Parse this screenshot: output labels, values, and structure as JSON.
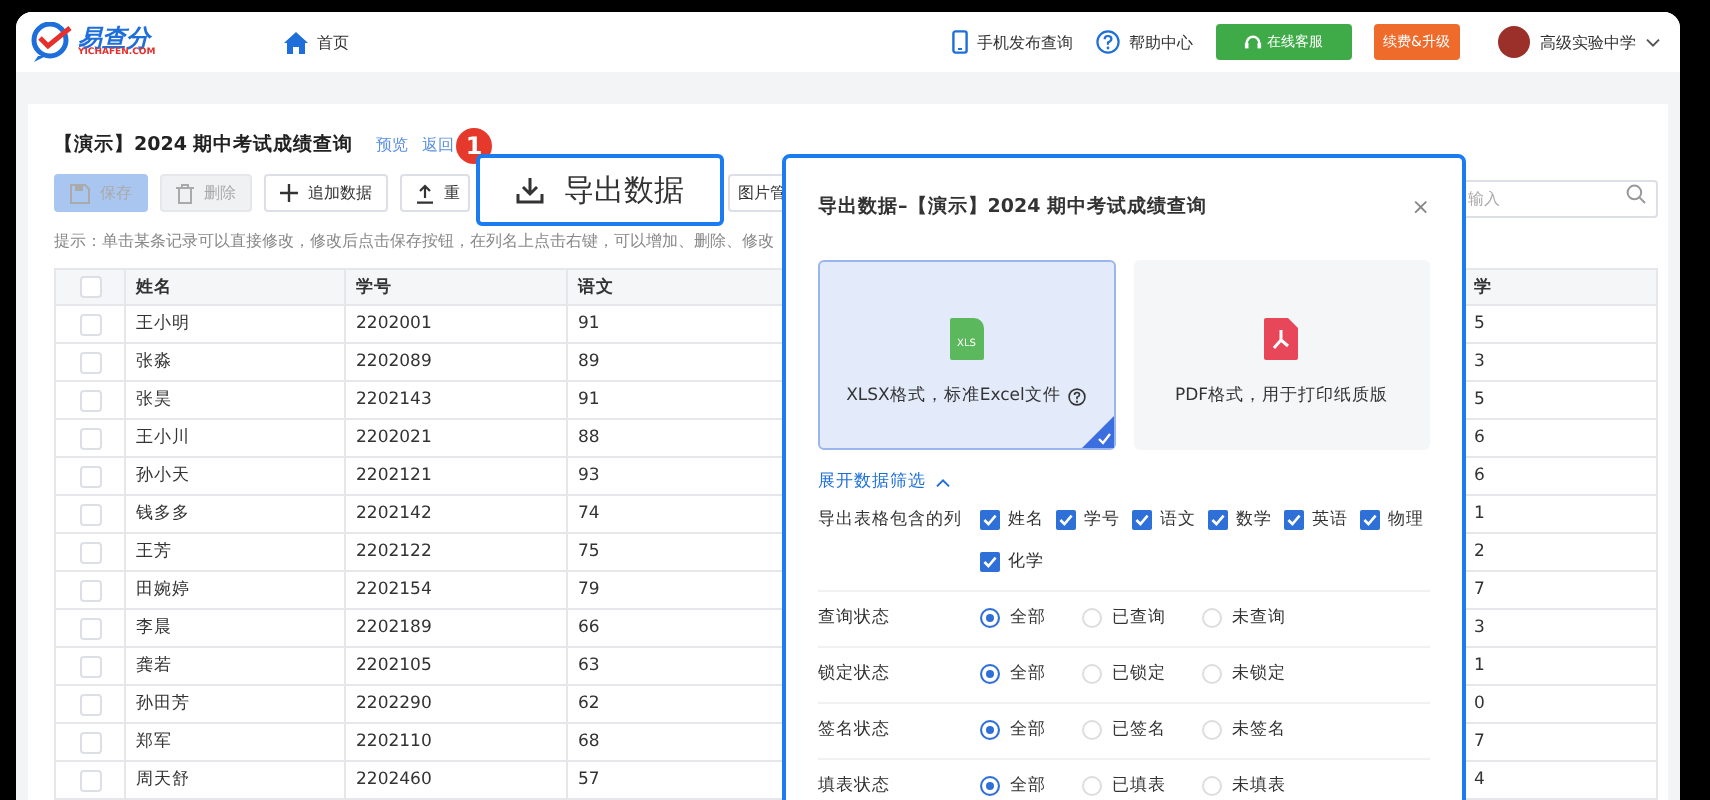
{
  "header": {
    "logo": {
      "name": "易查分",
      "domain": "YICHAFEN.COM"
    },
    "home": "首页",
    "links": [
      {
        "kind": "phone",
        "label": "手机发布查询"
      },
      {
        "kind": "help",
        "label": "帮助中心"
      }
    ],
    "buttons": [
      {
        "kind": "support",
        "label": "在线客服"
      },
      {
        "kind": "upgrade",
        "label": "续费&升级"
      }
    ],
    "user": "高级实验中学"
  },
  "page": {
    "title": "【演示】2024 期中考试成绩查询",
    "links": [
      "预览",
      "返回"
    ],
    "toolbar": [
      {
        "kind": "save",
        "label": "保存",
        "disabled": true
      },
      {
        "kind": "delete",
        "label": "删除",
        "disabled": true
      },
      {
        "kind": "add",
        "label": "追加数据",
        "disabled": false
      },
      {
        "kind": "import",
        "label": "重",
        "disabled": false
      },
      {
        "kind": "image",
        "label": "图片管",
        "disabled": false
      }
    ],
    "search": {
      "placeholder": "输入"
    },
    "hint": "提示：单击某条记录可以直接修改，修改后点击保存按钮，在列名上点击右键，可以增加、删除、修改"
  },
  "table": {
    "all_checked": false,
    "columns": [
      "姓名",
      "学号",
      "语文"
    ],
    "last_column": "学",
    "rows": [
      {
        "checked": false,
        "cells": [
          "王小明",
          "2202001",
          "91"
        ],
        "last": "5"
      },
      {
        "checked": false,
        "cells": [
          "张淼",
          "2202089",
          "89"
        ],
        "last": "3"
      },
      {
        "checked": false,
        "cells": [
          "张昊",
          "2202143",
          "91"
        ],
        "last": "5"
      },
      {
        "checked": false,
        "cells": [
          "王小川",
          "2202021",
          "88"
        ],
        "last": "6"
      },
      {
        "checked": false,
        "cells": [
          "孙小天",
          "2202121",
          "93"
        ],
        "last": "6"
      },
      {
        "checked": false,
        "cells": [
          "钱多多",
          "2202142",
          "74"
        ],
        "last": "1"
      },
      {
        "checked": false,
        "cells": [
          "王芳",
          "2202122",
          "75"
        ],
        "last": "2"
      },
      {
        "checked": false,
        "cells": [
          "田婉婷",
          "2202154",
          "79"
        ],
        "last": "7"
      },
      {
        "checked": false,
        "cells": [
          "李晨",
          "2202189",
          "66"
        ],
        "last": "3"
      },
      {
        "checked": false,
        "cells": [
          "龚若",
          "2202105",
          "63"
        ],
        "last": "1"
      },
      {
        "checked": false,
        "cells": [
          "孙田芳",
          "2202290",
          "62"
        ],
        "last": "0"
      },
      {
        "checked": false,
        "cells": [
          "郑军",
          "2202110",
          "68"
        ],
        "last": "7"
      },
      {
        "checked": false,
        "cells": [
          "周天舒",
          "2202460",
          "57"
        ],
        "last": "4"
      }
    ]
  },
  "callout": {
    "step": "1",
    "label": "导出数据"
  },
  "dialog": {
    "title": "导出数据–【演示】2024 期中考试成绩查询",
    "close": "×",
    "formats": [
      {
        "kind": "xlsx",
        "badge": "XLS",
        "label": "XLSX格式，标准Excel文件",
        "selected": true
      },
      {
        "kind": "pdf",
        "label": "PDF格式，用于打印纸质版",
        "selected": false
      }
    ],
    "filter_toggle": {
      "label": "展开数据筛选",
      "expanded": true
    },
    "column_filter": {
      "label": "导出表格包含的列",
      "options": [
        {
          "label": "姓名",
          "checked": true
        },
        {
          "label": "学号",
          "checked": true
        },
        {
          "label": "语文",
          "checked": true
        },
        {
          "label": "数学",
          "checked": true
        },
        {
          "label": "英语",
          "checked": true
        },
        {
          "label": "物理",
          "checked": true
        },
        {
          "label": "化学",
          "checked": true
        }
      ]
    },
    "radio_groups": [
      {
        "label": "查询状态",
        "options": [
          {
            "label": "全部",
            "selected": true
          },
          {
            "label": "已查询",
            "selected": false
          },
          {
            "label": "未查询",
            "selected": false
          }
        ]
      },
      {
        "label": "锁定状态",
        "options": [
          {
            "label": "全部",
            "selected": true
          },
          {
            "label": "已锁定",
            "selected": false
          },
          {
            "label": "未锁定",
            "selected": false
          }
        ]
      },
      {
        "label": "签名状态",
        "options": [
          {
            "label": "全部",
            "selected": true
          },
          {
            "label": "已签名",
            "selected": false
          },
          {
            "label": "未签名",
            "selected": false
          }
        ]
      },
      {
        "label": "填表状态",
        "options": [
          {
            "label": "全部",
            "selected": true
          },
          {
            "label": "已填表",
            "selected": false
          },
          {
            "label": "未填表",
            "selected": false
          }
        ]
      }
    ]
  }
}
